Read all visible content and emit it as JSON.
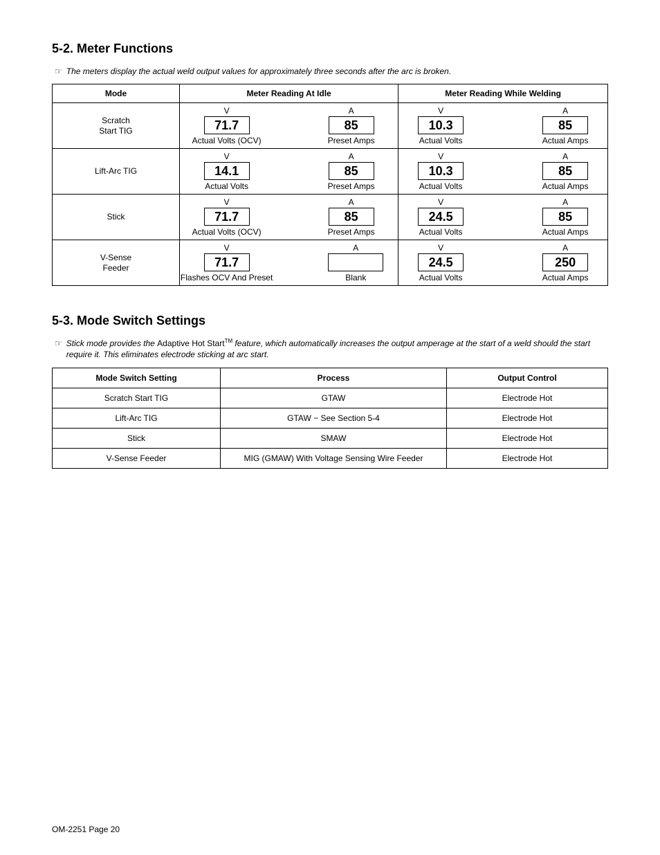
{
  "section1": {
    "heading": "5-2.  Meter Functions",
    "note_icon": "☞",
    "note": "The meters display the actual weld output values for approximately three seconds after the arc is broken.",
    "headers": {
      "mode": "Mode",
      "idle": "Meter Reading At Idle",
      "weld": "Meter Reading While Welding"
    },
    "rows": [
      {
        "mode_l1": "Scratch",
        "mode_l2": "Start TIG",
        "idle_v_top": "V",
        "idle_v_val": "71.7",
        "idle_v_bot": "Actual Volts (OCV)",
        "idle_a_top": "A",
        "idle_a_val": "85",
        "idle_a_bot": "Preset Amps",
        "weld_v_top": "V",
        "weld_v_val": "10.3",
        "weld_v_bot": "Actual Volts",
        "weld_a_top": "A",
        "weld_a_val": "85",
        "weld_a_bot": "Actual Amps"
      },
      {
        "mode_l1": "Lift-Arc TIG",
        "mode_l2": "",
        "idle_v_top": "V",
        "idle_v_val": "14.1",
        "idle_v_bot": "Actual Volts",
        "idle_a_top": "A",
        "idle_a_val": "85",
        "idle_a_bot": "Preset Amps",
        "weld_v_top": "V",
        "weld_v_val": "10.3",
        "weld_v_bot": "Actual Volts",
        "weld_a_top": "A",
        "weld_a_val": "85",
        "weld_a_bot": "Actual Amps"
      },
      {
        "mode_l1": "Stick",
        "mode_l2": "",
        "idle_v_top": "V",
        "idle_v_val": "71.7",
        "idle_v_bot": "Actual Volts (OCV)",
        "idle_a_top": "A",
        "idle_a_val": "85",
        "idle_a_bot": "Preset Amps",
        "weld_v_top": "V",
        "weld_v_val": "24.5",
        "weld_v_bot": "Actual Volts",
        "weld_a_top": "A",
        "weld_a_val": "85",
        "weld_a_bot": "Actual Amps"
      },
      {
        "mode_l1": "V-Sense",
        "mode_l2": "Feeder",
        "idle_v_top": "V",
        "idle_v_val": "71.7",
        "idle_v_bot": "Flashes OCV And Preset",
        "idle_a_top": "A",
        "idle_a_val": "",
        "idle_a_bot": "Blank",
        "weld_v_top": "V",
        "weld_v_val": "24.5",
        "weld_v_bot": "Actual Volts",
        "weld_a_top": "A",
        "weld_a_val": "250",
        "weld_a_bot": "Actual Amps"
      }
    ]
  },
  "section2": {
    "heading": "5-3.  Mode Switch Settings",
    "note_icon": "☞",
    "note_a": "Stick mode provides the ",
    "note_b_noital": "Adaptive Hot Start",
    "note_tm": "TM",
    "note_c": " feature, which automatically increases the output amperage at the start of a weld should the start require it. This eliminates electrode sticking at arc start.",
    "headers": {
      "c1": "Mode Switch Setting",
      "c2": "Process",
      "c3": "Output Control"
    },
    "rows": [
      {
        "c1": "Scratch Start TIG",
        "c2": "GTAW",
        "c3": "Electrode Hot"
      },
      {
        "c1": "Lift-Arc TIG",
        "c2": "GTAW − See Section 5-4",
        "c3": "Electrode Hot"
      },
      {
        "c1": "Stick",
        "c2": "SMAW",
        "c3": "Electrode Hot"
      },
      {
        "c1": "V-Sense Feeder",
        "c2": "MIG (GMAW) With Voltage Sensing Wire Feeder",
        "c3": "Electrode Hot"
      }
    ]
  },
  "footer": "OM-2251 Page 20"
}
